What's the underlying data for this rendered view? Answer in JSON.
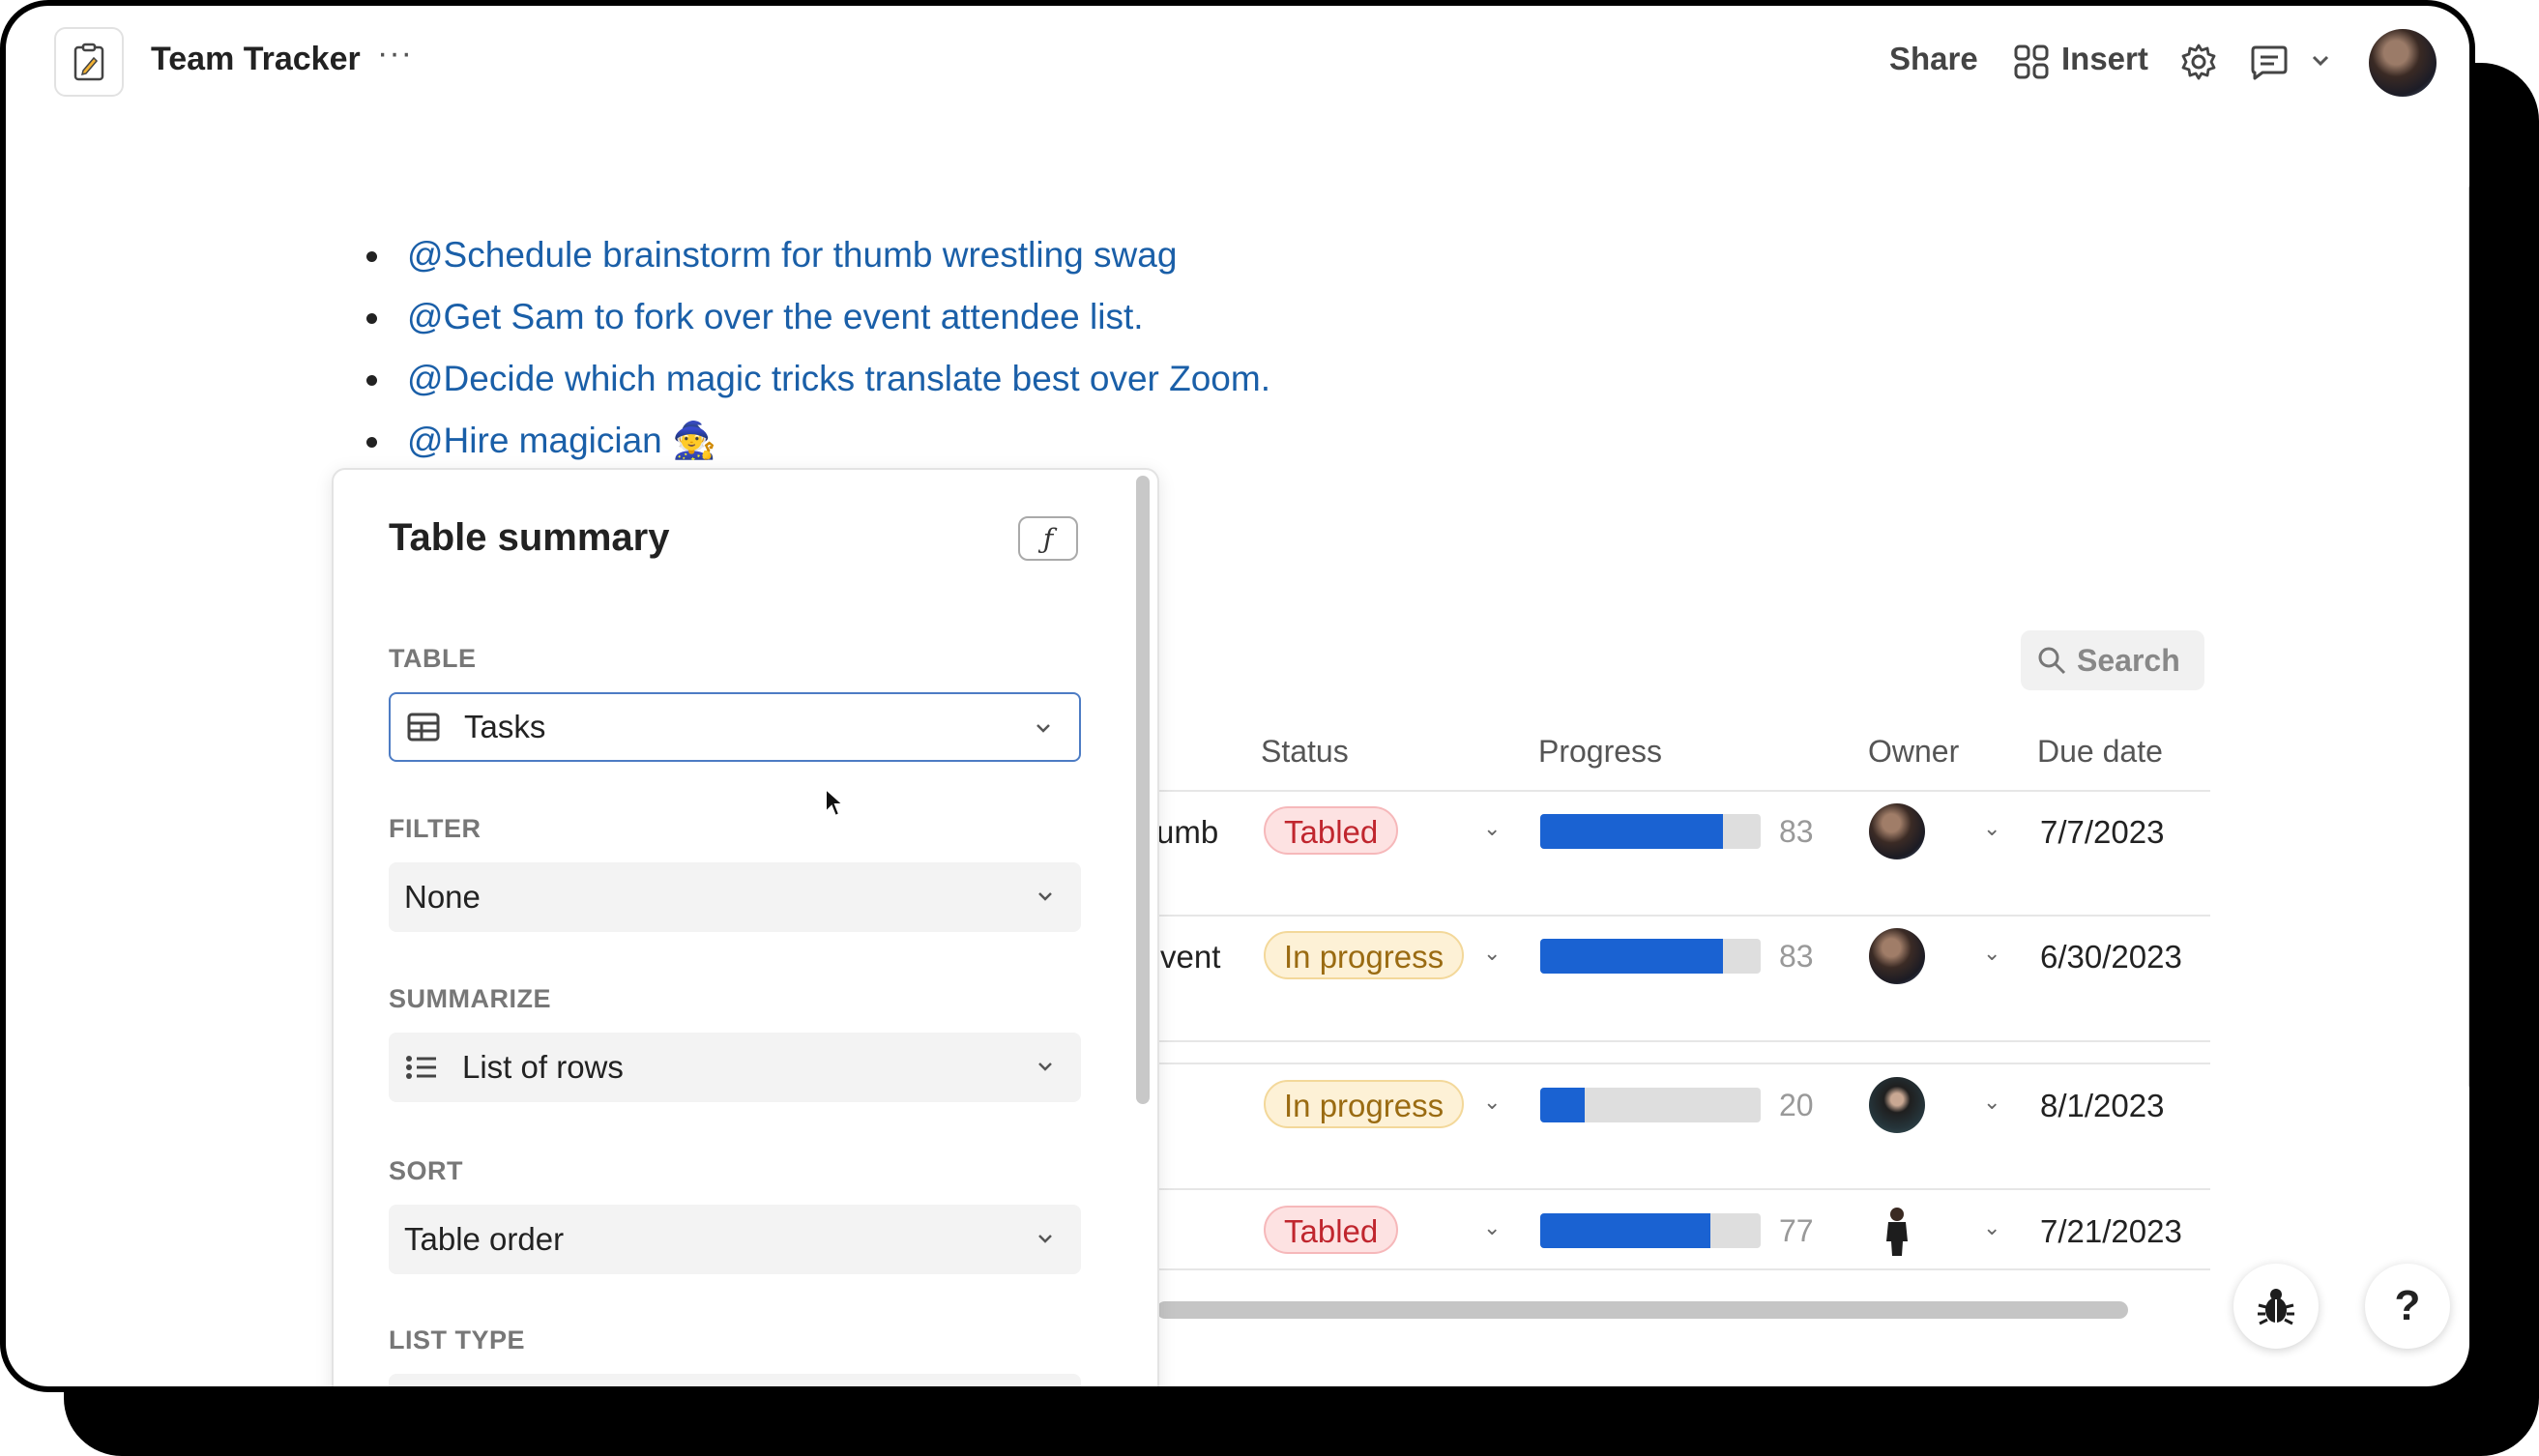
{
  "app": {
    "title": "Team Tracker",
    "more_label": "···",
    "share_label": "Share",
    "insert_label": "Insert"
  },
  "bullets": [
    "@Schedule brainstorm for thumb wrestling swag",
    "@Get Sam to fork over the event attendee list.",
    "@Decide which magic tricks translate best over Zoom.",
    "@Hire magician 🧙"
  ],
  "table": {
    "search_label": "Search",
    "columns": [
      "Status",
      "Progress",
      "Owner",
      "Due date"
    ],
    "rows": [
      {
        "name_fragment": "umb",
        "status": "Tabled",
        "progress": 83,
        "due": "7/7/2023"
      },
      {
        "name_fragment": "vent",
        "status": "In progress",
        "progress": 83,
        "due": "6/30/2023"
      },
      {
        "name_fragment": "",
        "status": "In progress",
        "progress": 20,
        "due": "8/1/2023"
      },
      {
        "name_fragment": "",
        "status": "Tabled",
        "progress": 77,
        "due": "7/21/2023"
      }
    ]
  },
  "panel": {
    "title": "Table summary",
    "formula_label": "ƒ",
    "table_label": "TABLE",
    "table_value": "Tasks",
    "filter_label": "FILTER",
    "filter_value": "None",
    "summarize_label": "SUMMARIZE",
    "summarize_value": "List of rows",
    "sort_label": "SORT",
    "sort_value": "Table order",
    "list_type_label": "LIST TYPE"
  },
  "help_label": "?",
  "colors": {
    "link": "#1a5fa8",
    "progress": "#1a62d2",
    "tabled_bg": "#fde2e2",
    "tabled_fg": "#c0262e",
    "inprog_bg": "#fdf1d6",
    "inprog_fg": "#9a6b12"
  }
}
